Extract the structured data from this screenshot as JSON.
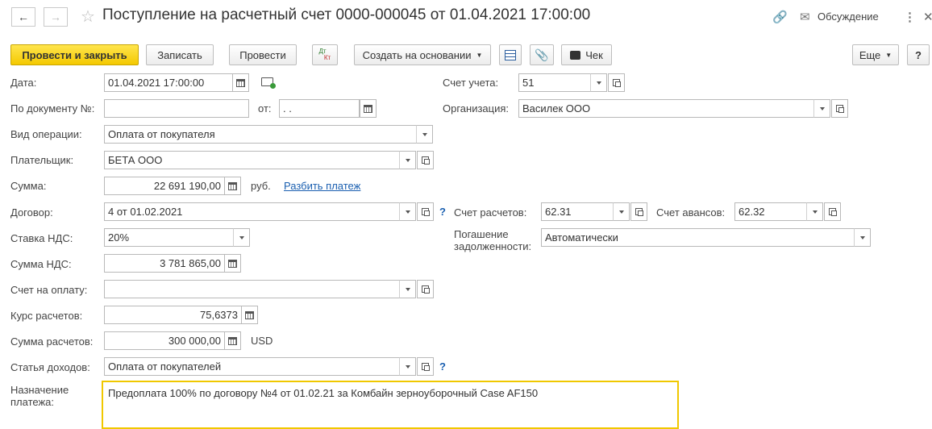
{
  "header": {
    "title": "Поступление на расчетный счет 0000-000045 от 01.04.2021 17:00:00",
    "discussion_label": "Обсуждение"
  },
  "toolbar": {
    "post_close_label": "Провести и закрыть",
    "save_label": "Записать",
    "post_label": "Провести",
    "dtkt_top": "Дт",
    "dtkt_bottom": "Кт",
    "create_based_label": "Создать на основании",
    "receipt_label": "Чек",
    "more_label": "Еще",
    "help_label": "?"
  },
  "form": {
    "date": {
      "label": "Дата:",
      "value": "01.04.2021 17:00:00"
    },
    "by_document": {
      "label": "По документу №:",
      "value": "",
      "from_label": "от:",
      "from_value": " .  . "
    },
    "operation_type": {
      "label": "Вид операции:",
      "value": "Оплата от покупателя"
    },
    "payer": {
      "label": "Плательщик:",
      "value": "БЕТА ООО"
    },
    "amount": {
      "label": "Сумма:",
      "value": "22 691 190,00",
      "currency": "руб.",
      "split_link": "Разбить платеж"
    },
    "contract": {
      "label": "Договор:",
      "value": "4 от 01.02.2021",
      "help": "?"
    },
    "vat_rate": {
      "label": "Ставка НДС:",
      "value": "20%"
    },
    "vat_amount": {
      "label": "Сумма НДС:",
      "value": "3 781 865,00"
    },
    "invoice": {
      "label": "Счет на оплату:",
      "value": ""
    },
    "rate": {
      "label": "Курс расчетов:",
      "value": "75,6373"
    },
    "settlement_amount": {
      "label": "Сумма расчетов:",
      "value": "300 000,00",
      "currency": "USD"
    },
    "income_item": {
      "label": "Статья доходов:",
      "value": "Оплата от покупателей",
      "help": "?"
    },
    "purpose": {
      "label_line1": "Назначение",
      "label_line2": "платежа:",
      "value": "Предоплата 100% по договору №4 от 01.02.21 за Комбайн зерноуборочный Case AF150"
    },
    "account": {
      "label": "Счет учета:",
      "value": "51"
    },
    "organization": {
      "label": "Организация:",
      "value": "Василек ООО"
    },
    "settlement_account": {
      "label": "Счет расчетов:",
      "value": "62.31"
    },
    "advance_account": {
      "label": "Счет авансов:",
      "value": "62.32"
    },
    "debt_repayment": {
      "label_line1": "Погашение",
      "label_line2": "задолженности:",
      "value": "Автоматически"
    }
  },
  "colors": {
    "primary_button": "#f4c900",
    "link": "#1a5fb0",
    "focus_border": "#f0c800"
  }
}
